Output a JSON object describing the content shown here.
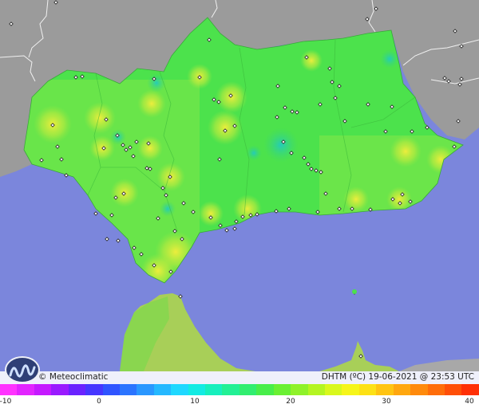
{
  "map": {
    "brand": "© Meteoclimatic",
    "variable": "DHTM (ºC)",
    "datetime": "19-06-2021 @ 23:53 UTC",
    "colors": {
      "sea": "#7b86dc",
      "land_outside": "#9b9b9b",
      "land_base": "#4ce24c",
      "africa_land": "#a8cf58",
      "border": "#ffffff"
    }
  },
  "legend": {
    "ticks": [
      "-10",
      "0",
      "10",
      "20",
      "30",
      "40"
    ],
    "min": -10,
    "max": 40,
    "colors": [
      "#ff33ff",
      "#e224ff",
      "#c519ff",
      "#9a1aff",
      "#6a22ff",
      "#4636ff",
      "#2f54ff",
      "#2b74ff",
      "#2a97ff",
      "#25b8ff",
      "#1fd8ff",
      "#13ebe3",
      "#17efbd",
      "#22f095",
      "#31ee70",
      "#48ee4a",
      "#6af033",
      "#8ff22a",
      "#b4f522",
      "#d9f81d",
      "#f6f51a",
      "#fde115",
      "#ffc412",
      "#ffa70f",
      "#ff8a0c",
      "#ff6d0a",
      "#ff4f08",
      "#ff3006"
    ]
  }
}
